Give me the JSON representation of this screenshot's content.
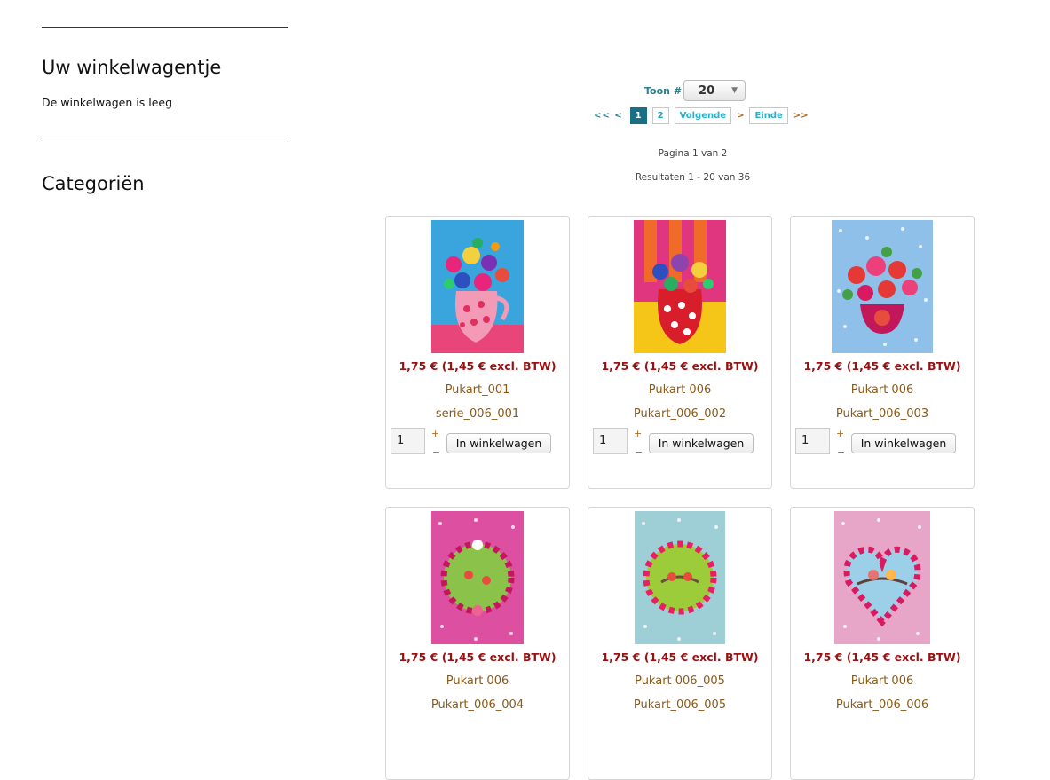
{
  "sidebar": {
    "cart_title": "Uw winkelwagentje",
    "cart_empty": "De winkelwagen is leeg",
    "categories_title": "Categoriën"
  },
  "listing": {
    "show_label": "Toon #",
    "show_value": "20",
    "first_arrows": "<< <",
    "pages": [
      "1",
      "2"
    ],
    "current_page": "1",
    "next_label": "Volgende",
    "next_arrow": ">",
    "end_label": "Einde",
    "end_arrow": ">>",
    "page_info": "Pagina 1 van 2",
    "results_info": "Resultaten 1 - 20 van 36"
  },
  "colors": {
    "price": "#9b1010",
    "product_text": "#8a5a1a",
    "link": "#2a9bb5",
    "active_page": "#1a6f86"
  },
  "products": [
    {
      "price": "1,75 € (1,45 € excl. BTW)",
      "name": "Pukart_001",
      "sku": "serie_006_001",
      "qty": "1",
      "plus": "+",
      "minus": "−",
      "button": "In winkelwagen",
      "image": "pink-vase-flowers-blue-bg"
    },
    {
      "price": "1,75 € (1,45 € excl. BTW)",
      "name": "Pukart 006",
      "sku": "Pukart_006_002",
      "qty": "1",
      "plus": "+",
      "minus": "−",
      "button": "In winkelwagen",
      "image": "red-polka-vase-striped-bg"
    },
    {
      "price": "1,75 € (1,45 € excl. BTW)",
      "name": "Pukart 006",
      "sku": "Pukart_006_003",
      "qty": "1",
      "plus": "+",
      "minus": "−",
      "button": "In winkelwagen",
      "image": "pink-bowl-flowers-blue-dots"
    },
    {
      "price": "1,75 € (1,45 € excl. BTW)",
      "name": "Pukart 006",
      "sku": "Pukart_006_004",
      "image": "flower-wreath-pink-bg"
    },
    {
      "price": "1,75 € (1,45 € excl. BTW)",
      "name": "Pukart 006_005",
      "sku": "Pukart_006_005",
      "image": "flower-wreath-blue-bg"
    },
    {
      "price": "1,75 € (1,45 € excl. BTW)",
      "name": "Pukart 006",
      "sku": "Pukart_006_006",
      "image": "heart-wreath-birds-pink-bg"
    }
  ]
}
